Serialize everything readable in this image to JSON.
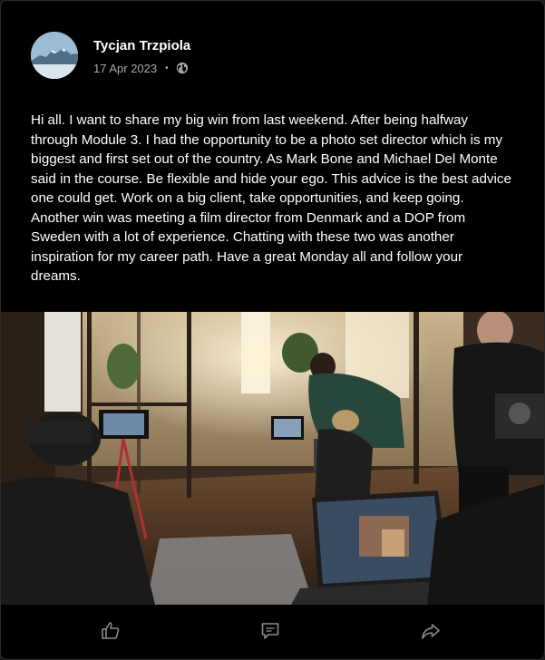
{
  "post": {
    "author": "Tycjan Trzpiola",
    "date": "17 Apr 2023",
    "separator": "•",
    "visibility_icon": "globe-icon",
    "text": "Hi all. I want to share my big win from last weekend. After being halfway through Module 3. I had the opportunity to be a photo set director which is my biggest and first set out of the country. As Mark Bone and Michael Del Monte said in the course. Be flexible and hide your ego. This advice is the best advice one could get. Work on a big client, take opportunities, and keep going. Another win was meeting a film director from Denmark and a DOP from Sweden with a lot of experience. Chatting with these two was another inspiration for my career path. Have a great Monday all and follow your dreams."
  },
  "actions": {
    "like_icon": "thumbs-up-icon",
    "comment_icon": "comment-icon",
    "share_icon": "share-arrow-icon"
  },
  "colors": {
    "background": "#000000",
    "text": "#ffffff",
    "muted": "#a8a8a8",
    "icon": "#8a8a8a"
  }
}
